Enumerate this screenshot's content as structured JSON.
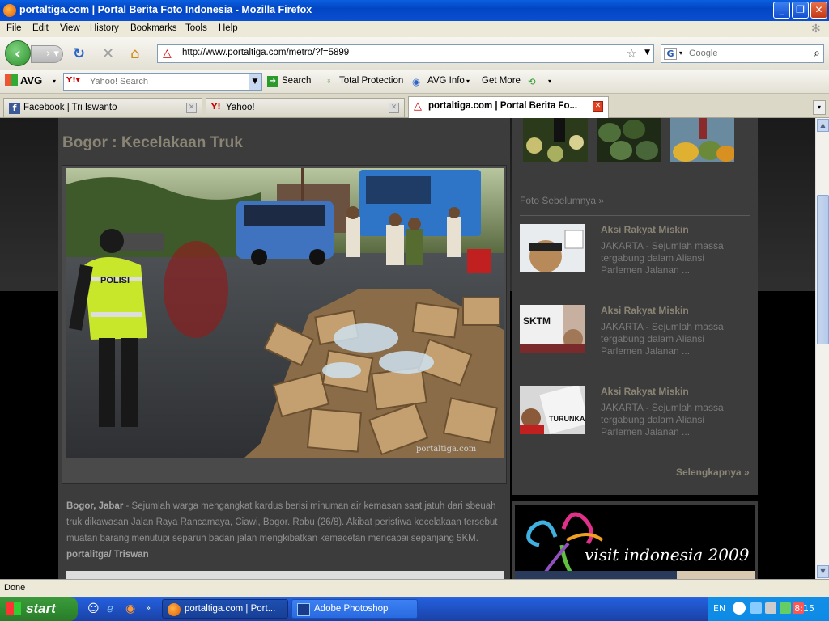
{
  "window": {
    "title": "portaltiga.com | Portal Berita Foto Indonesia - Mozilla Firefox"
  },
  "menu": [
    "File",
    "Edit",
    "View",
    "History",
    "Bookmarks",
    "Tools",
    "Help"
  ],
  "nav": {
    "url": "http://www.portaltiga.com/metro/?f=5899",
    "search_placeholder": "Google"
  },
  "avg_toolbar": {
    "logo": "AVG",
    "yahoo_placeholder": "Yahoo! Search",
    "search_label": "Search",
    "total_protection": "Total Protection",
    "avg_info": "AVG Info",
    "get_more": "Get More"
  },
  "tabs": [
    {
      "label": "Facebook | Tri Iswanto",
      "icon": "facebook-icon"
    },
    {
      "label": "Yahoo!",
      "icon": "yahoo-icon"
    },
    {
      "label": "portaltiga.com | Portal Berita Fo...",
      "icon": "warning-icon",
      "active": true
    }
  ],
  "page": {
    "heading": "Bogor : Kecelakaan Truk",
    "watermark": "portaltiga.com",
    "caption_location": "Bogor, Jabar",
    "caption_text": " - Sejumlah warga mengangkat kardus berisi minuman air kemasan saat jatuh dari sbeuah truk dikawasan Jalan Raya Rancamaya, Ciawi, Bogor. Rabu (26/8). Akibat peristiwa kecelakaan tersebut muatan barang menutupi separuh badan jalan mengkibatkan kemacetan mencapai sepanjang 5KM. ",
    "caption_credit": "portalitga/ Triswan",
    "sidebar_heading": "Foto Sebelumnya »",
    "items": [
      {
        "title": "Aksi Rakyat Miskin",
        "desc": "JAKARTA - Sejumlah massa tergabung dalam Aliansi Parlemen Jalanan ..."
      },
      {
        "title": "Aksi Rakyat Miskin",
        "desc": "JAKARTA - Sejumlah massa tergabung dalam Aliansi Parlemen Jalanan ..."
      },
      {
        "title": "Aksi Rakyat Miskin",
        "desc": "JAKARTA - Sejumlah massa tergabung dalam Aliansi Parlemen Jalanan ..."
      }
    ],
    "more_link": "Selengkapnya »",
    "ad_text": "visit indonesia 2009"
  },
  "status": "Done",
  "taskbar": {
    "start": "start",
    "tasks": [
      "portaltiga.com | Port...",
      "Adobe Photoshop"
    ],
    "lang": "EN",
    "time": "8:15"
  },
  "colors": {
    "heading": "#8a8474",
    "page_bg": "#3c3c3c",
    "titlebar": "#0a4fd2"
  }
}
